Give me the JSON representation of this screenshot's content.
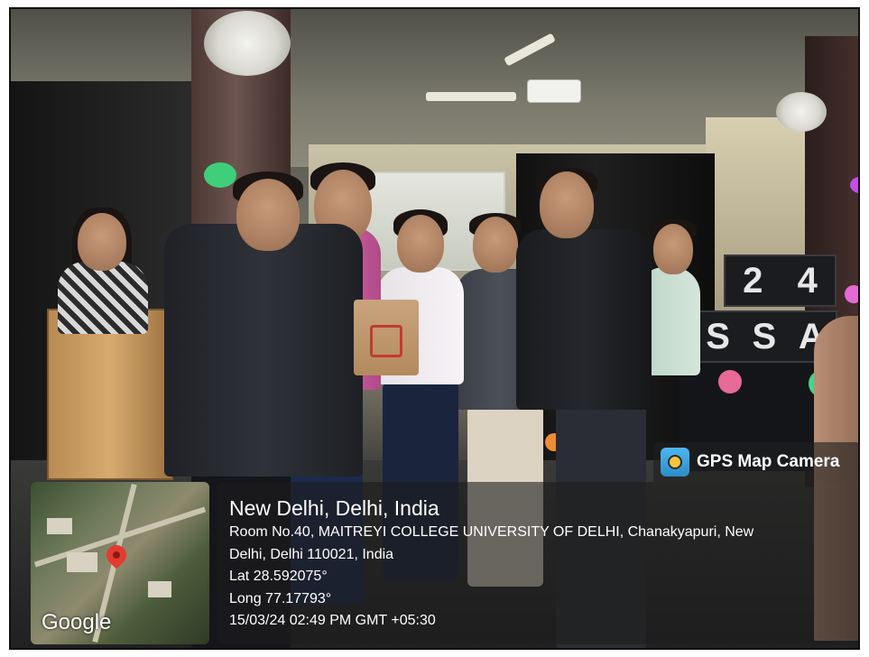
{
  "stage_decor": {
    "block_top": [
      "2",
      "4"
    ],
    "block_bottom": [
      "S",
      "S",
      "A"
    ]
  },
  "gps_overlay": {
    "app_label": "GPS Map Camera",
    "app_icon": "gps-map-camera-icon",
    "map_brand": "Google",
    "location_title": "New Delhi, Delhi, India",
    "address_line_1": "Room No.40, MAITREYI COLLEGE UNIVERSITY OF DELHI, Chanakyapuri, New",
    "address_line_2": "Delhi, Delhi 110021, India",
    "latitude": "Lat 28.592075°",
    "longitude": "Long 77.17793°",
    "timestamp": "15/03/24 02:49 PM GMT +05:30"
  },
  "colors": {
    "overlay_bg": "#1c1c1c",
    "overlay_text": "#ffffff",
    "map_pin": "#e43b2f"
  }
}
